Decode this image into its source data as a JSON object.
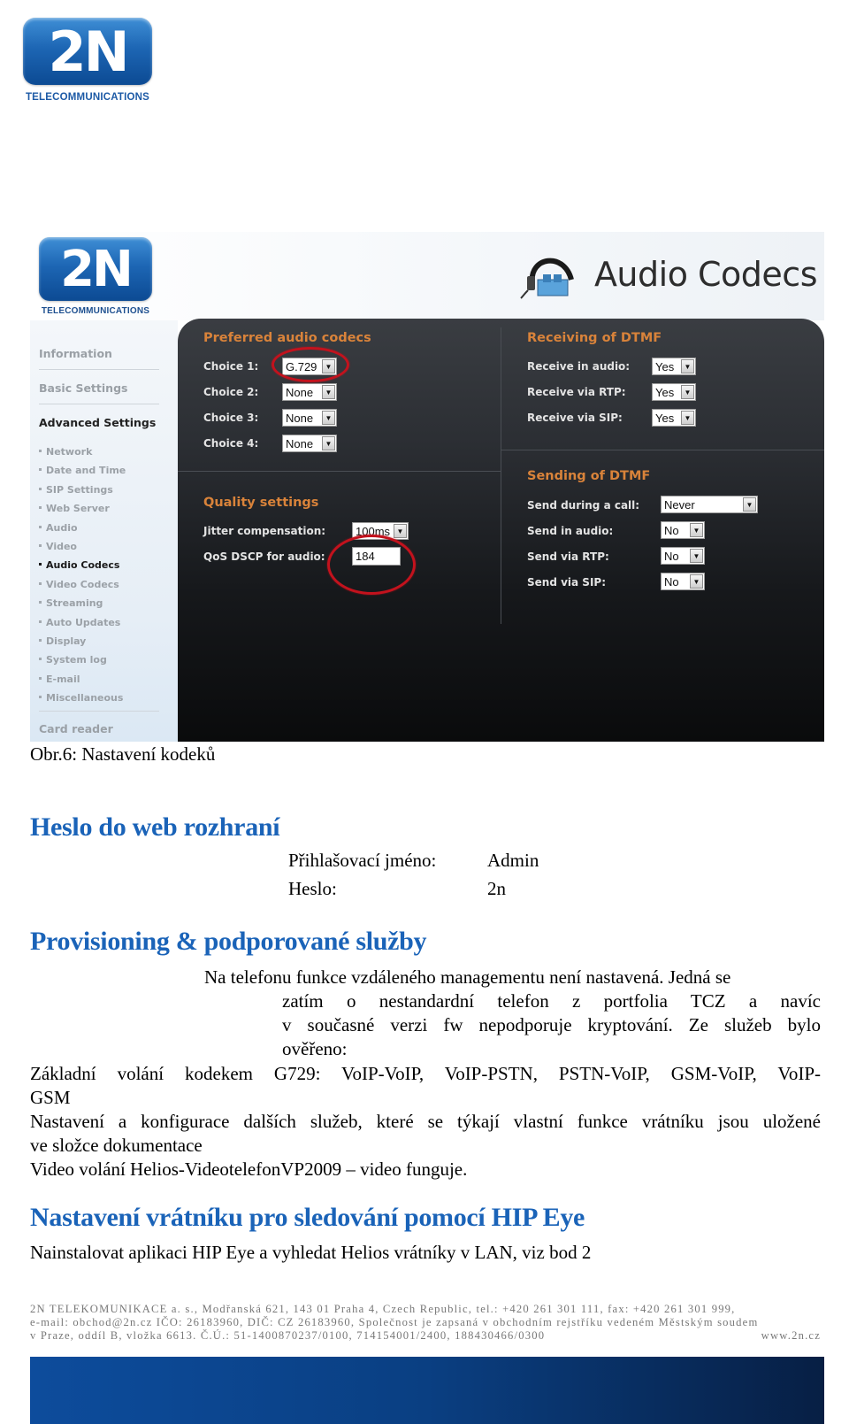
{
  "page_logo": {
    "mark": "2N",
    "subtitle": "TELECOMMUNICATIONS"
  },
  "figure": {
    "logo": {
      "mark": "2N",
      "subtitle": "TELECOMMUNICATIONS"
    },
    "page_title": "Audio Codecs",
    "page_icon": "headphones-icon",
    "sidebar": {
      "sections": [
        {
          "label": "Information",
          "active": false
        },
        {
          "label": "Basic Settings",
          "active": false
        },
        {
          "label": "Advanced Settings",
          "active": true
        }
      ],
      "subitems": [
        {
          "label": "Network",
          "active": false
        },
        {
          "label": "Date and Time",
          "active": false
        },
        {
          "label": "SIP Settings",
          "active": false
        },
        {
          "label": "Web Server",
          "active": false
        },
        {
          "label": "Audio",
          "active": false
        },
        {
          "label": "Video",
          "active": false
        },
        {
          "label": "Audio Codecs",
          "active": true
        },
        {
          "label": "Video Codecs",
          "active": false
        },
        {
          "label": "Streaming",
          "active": false
        },
        {
          "label": "Auto Updates",
          "active": false
        },
        {
          "label": "Display",
          "active": false
        },
        {
          "label": "System log",
          "active": false
        },
        {
          "label": "E-mail",
          "active": false
        },
        {
          "label": "Miscellaneous",
          "active": false
        }
      ],
      "footer_item": "Card reader"
    },
    "preferred_codecs": {
      "title": "Preferred audio codecs",
      "fields": [
        {
          "label": "Choice 1:",
          "value": "G.729"
        },
        {
          "label": "Choice 2:",
          "value": "None"
        },
        {
          "label": "Choice 3:",
          "value": "None"
        },
        {
          "label": "Choice 4:",
          "value": "None"
        }
      ]
    },
    "quality": {
      "title": "Quality settings",
      "jitter_label": "Jitter compensation:",
      "jitter_value": "100ms",
      "qos_label": "QoS DSCP for audio:",
      "qos_value": "184"
    },
    "receiving_dtmf": {
      "title": "Receiving of DTMF",
      "fields": [
        {
          "label": "Receive in audio:",
          "value": "Yes"
        },
        {
          "label": "Receive via RTP:",
          "value": "Yes"
        },
        {
          "label": "Receive via SIP:",
          "value": "Yes"
        }
      ]
    },
    "sending_dtmf": {
      "title": "Sending of DTMF",
      "fields": [
        {
          "label": "Send during a call:",
          "value": "Never"
        },
        {
          "label": "Send in audio:",
          "value": "No"
        },
        {
          "label": "Send via RTP:",
          "value": "No"
        },
        {
          "label": "Send via SIP:",
          "value": "No"
        }
      ]
    },
    "highlight_color": "#c3121d",
    "accent_color": "#d9833a"
  },
  "caption": "Obr.6: Nastavení kodeků",
  "sections": {
    "password": {
      "heading": "Heslo do web rozhraní",
      "login_label": "Přihlašovací jméno:",
      "login_value": "Admin",
      "password_label": "Heslo:",
      "password_value": "2n"
    },
    "provisioning": {
      "heading": "Provisioning & podporované služby",
      "indented_lines": [
        "Na telefonu funkce vzdáleného managementu není nastavená. Jedná se",
        "zatím o nestandardní telefon z portfolia TCZ a navíc",
        "v současné verzi fw nepodporuje kryptování. Ze služeb bylo",
        "ověřeno:"
      ],
      "lines": [
        "Základní volání kodekem G729: VoIP-VoIP, VoIP-PSTN, PSTN-VoIP, GSM-VoIP, VoIP-",
        "GSM",
        "Nastavení a konfigurace dalších služeb, které se týkají vlastní funkce vrátníku jsou uložené",
        "ve složce dokumentace",
        "Video volání Helios-VideotelefonVP2009 – video funguje."
      ]
    },
    "hip_eye": {
      "heading": "Nastavení vrátníku pro sledování pomocí HIP Eye",
      "text": "Nainstalovat aplikaci HIP Eye a vyhledat Helios vrátníky v LAN, viz bod 2"
    }
  },
  "footer": {
    "line1": "2N TELEKOMUNIKACE a. s., Modřanská 621, 143 01 Praha 4, Czech Republic, tel.: +420 261 301 111, fax: +420 261 301 999,",
    "line2": "e-mail: obchod@2n.cz  IČO: 26183960, DIČ: CZ 26183960, Společnost je zapsaná v obchodním rejstříku vedeném Městským soudem",
    "line3": "v Praze, oddíl B, vložka 6613. Č.Ú.: 51-1400870237/0100, 714154001/2400,  188430466/0300",
    "website": "www.2n.cz"
  }
}
